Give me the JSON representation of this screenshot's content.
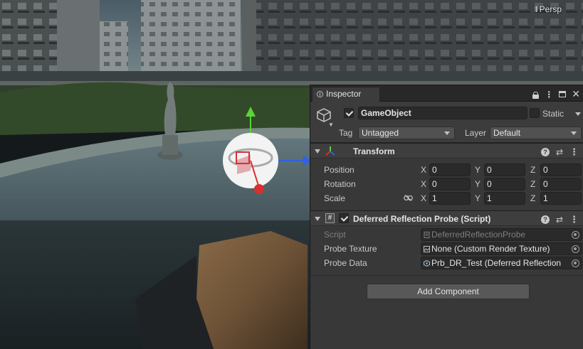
{
  "scene": {
    "view_mode": "Persp"
  },
  "inspector": {
    "tab_title": "Inspector",
    "header": {
      "active": true,
      "name": "GameObject",
      "static_label": "Static",
      "static_checked": false,
      "tag_label": "Tag",
      "tag_value": "Untagged",
      "layer_label": "Layer",
      "layer_value": "Default"
    },
    "transform": {
      "title": "Transform",
      "position": {
        "label": "Position",
        "x": "0",
        "y": "0",
        "z": "0"
      },
      "rotation": {
        "label": "Rotation",
        "x": "0",
        "y": "0",
        "z": "0"
      },
      "scale": {
        "label": "Scale",
        "x": "1",
        "y": "1",
        "z": "1"
      },
      "axis_x": "X",
      "axis_y": "Y",
      "axis_z": "Z"
    },
    "script_component": {
      "enabled": true,
      "title": "Deferred Reflection Probe (Script)",
      "script_label": "Script",
      "script_value": "DeferredReflectionProbe",
      "probe_texture_label": "Probe Texture",
      "probe_texture_value": "None (Custom Render Texture)",
      "probe_data_label": "Probe Data",
      "probe_data_value": "Prb_DR_Test (Deferred Reflection"
    },
    "add_component_label": "Add Component"
  },
  "colors": {
    "axis_x": "#d8302e",
    "axis_y": "#5cd336",
    "axis_z": "#2f62e5"
  }
}
